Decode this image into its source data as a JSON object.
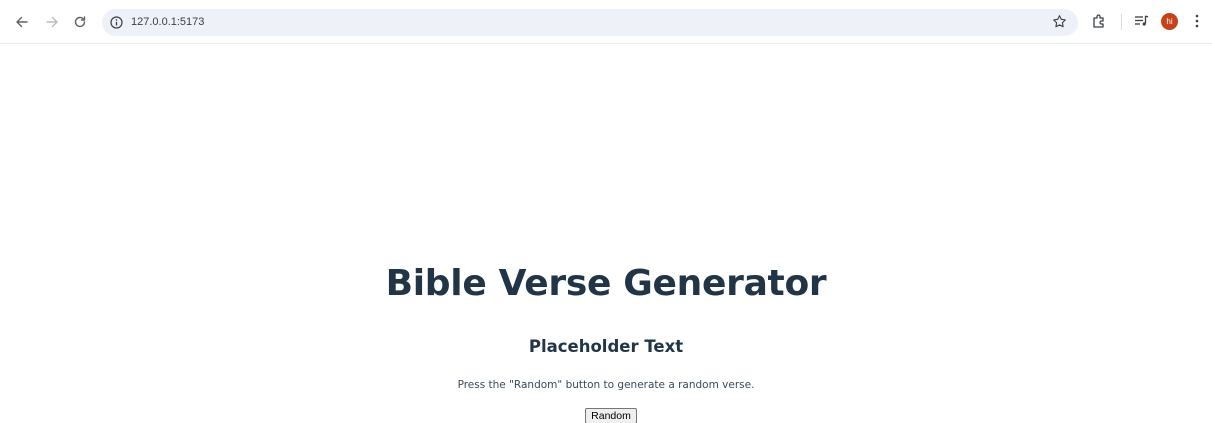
{
  "browser": {
    "url": "127.0.0.1:5173",
    "profile_initials": "hi",
    "icons": {
      "back": "arrow-left-icon",
      "forward": "arrow-right-icon",
      "reload": "reload-icon",
      "site_info": "info-icon",
      "bookmark": "star-icon",
      "extensions": "puzzle-icon",
      "media": "media-queue-icon",
      "menu": "kebab-menu-icon"
    },
    "colors": {
      "avatar_bg": "#c5421a",
      "omnibox_bg": "#eef1f8"
    }
  },
  "page": {
    "title": "Bible Verse Generator",
    "subtitle": "Placeholder Text",
    "instructions": "Press the \"Random\" button to generate a random verse.",
    "random_button_label": "Random",
    "colors": {
      "heading": "#213547"
    }
  }
}
